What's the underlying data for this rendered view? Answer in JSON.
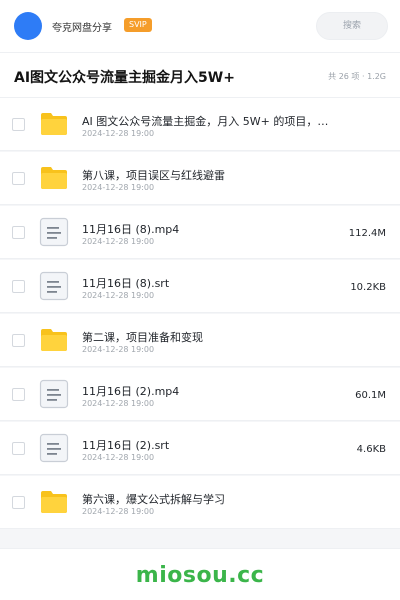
{
  "header": {
    "username": "夸克网盘分享",
    "vip_badge": "SVIP",
    "search_placeholder": "搜索"
  },
  "folder": {
    "title": "AI图文公众号流量主掘金月入5W+",
    "meta": "共 26 项 · 1.2G"
  },
  "files": [
    {
      "name": "AI 图文公众号流量主掘金，月入 5W+ 的项目，…",
      "date": "2024-12-28 19:00",
      "size": "",
      "type": "folder"
    },
    {
      "name": "第八课，项目误区与红线避雷",
      "date": "2024-12-28 19:00",
      "size": "",
      "type": "folder"
    },
    {
      "name": "11月16日 (8).mp4",
      "date": "2024-12-28 19:00",
      "size": "112.4M",
      "type": "file"
    },
    {
      "name": "11月16日 (8).srt",
      "date": "2024-12-28 19:00",
      "size": "10.2KB",
      "type": "file"
    },
    {
      "name": "第二课，项目准备和变现",
      "date": "2024-12-28 19:00",
      "size": "",
      "type": "folder"
    },
    {
      "name": "11月16日 (2).mp4",
      "date": "2024-12-28 19:00",
      "size": "60.1M",
      "type": "file"
    },
    {
      "name": "11月16日 (2).srt",
      "date": "2024-12-28 19:00",
      "size": "4.6KB",
      "type": "file"
    },
    {
      "name": "第六课，爆文公式拆解与学习",
      "date": "2024-12-28 19:00",
      "size": "",
      "type": "folder"
    }
  ],
  "footer": {
    "watermark": "miosou.cc"
  },
  "colors": {
    "accent": "#2e7cf6",
    "vip": "#f59d2a",
    "folder": "#f8c21c",
    "watermark": "#3bb54a"
  }
}
